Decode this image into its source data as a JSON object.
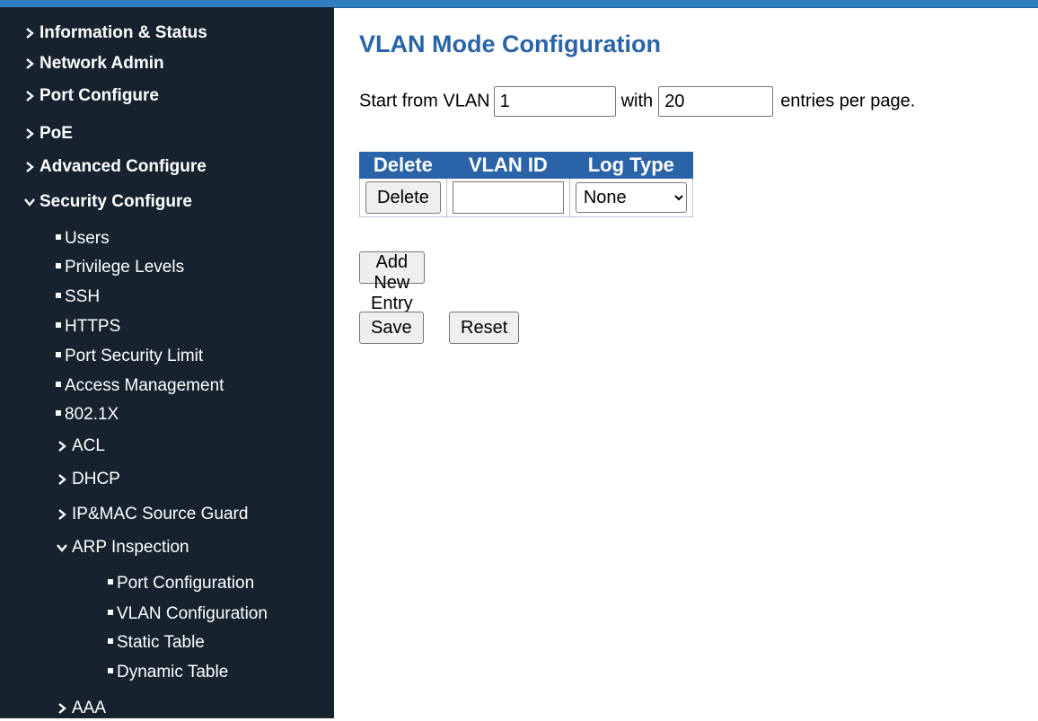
{
  "sidebar": {
    "items": [
      {
        "label": "Information & Status",
        "icon": "chevron-right-icon"
      },
      {
        "label": "Network Admin",
        "icon": "chevron-right-icon"
      },
      {
        "label": "Port Configure",
        "icon": "chevron-right-icon"
      },
      {
        "label": "PoE",
        "icon": "chevron-right-icon"
      },
      {
        "label": "Advanced Configure",
        "icon": "chevron-right-icon"
      },
      {
        "label": "Security Configure",
        "icon": "chevron-down-icon"
      }
    ],
    "security": {
      "items": [
        {
          "label": "Users"
        },
        {
          "label": "Privilege Levels"
        },
        {
          "label": "SSH"
        },
        {
          "label": "HTTPS"
        },
        {
          "label": "Port Security Limit"
        },
        {
          "label": "Access Management"
        },
        {
          "label": "802.1X"
        },
        {
          "label": "ACL",
          "icon": "chevron-right-icon"
        },
        {
          "label": "DHCP",
          "icon": "chevron-right-icon"
        },
        {
          "label": "IP&MAC Source Guard",
          "icon": "chevron-right-icon"
        },
        {
          "label": "ARP Inspection",
          "icon": "chevron-down-icon"
        }
      ],
      "arp": {
        "items": [
          {
            "label": "Port Configuration"
          },
          {
            "label": "VLAN Configuration"
          },
          {
            "label": "Static Table"
          },
          {
            "label": "Dynamic Table"
          }
        ]
      },
      "aaa": {
        "label": "AAA",
        "icon": "chevron-right-icon"
      }
    }
  },
  "main": {
    "title": "VLAN Mode Configuration",
    "paging": {
      "prefix": "Start from VLAN",
      "start_value": "1",
      "middle": "with",
      "count_value": "20",
      "suffix": "entries per page."
    },
    "table": {
      "headers": [
        "Delete",
        "VLAN ID",
        "Log Type"
      ],
      "row": {
        "delete_label": "Delete",
        "vlan_id_value": "",
        "log_type_selected": "None"
      }
    },
    "buttons": {
      "add_new_entry": "Add New Entry",
      "save": "Save",
      "reset": "Reset"
    }
  },
  "colors": {
    "sidebar_bg": "#16222e",
    "accent": "#2a63a8",
    "top_strip": "#2f7fc1"
  }
}
